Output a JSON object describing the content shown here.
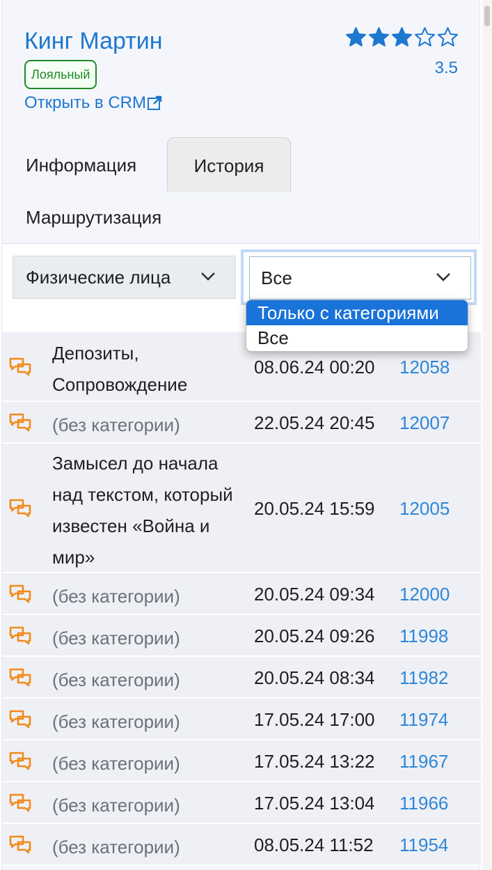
{
  "client": {
    "name": "Кинг Мартин",
    "badge": "Лояльный",
    "crm_link": "Открыть в CRM",
    "rating": "3.5",
    "rating_value": 3.5,
    "rating_max": 5
  },
  "tabs": [
    {
      "label": "Информация",
      "active": false
    },
    {
      "label": "История",
      "active": true
    },
    {
      "label": "Маршрутизация",
      "active": false
    }
  ],
  "filters": {
    "client_type": {
      "value": "Физические лица"
    },
    "category": {
      "value": "Все",
      "options": [
        {
          "label": "Только с категориями",
          "highlighted": true
        },
        {
          "label": "Все",
          "highlighted": false
        }
      ]
    }
  },
  "history": [
    {
      "category": "Депозиты, Сопровождение",
      "has_category": true,
      "date": "08.06.24 00:20",
      "id": "12058"
    },
    {
      "category": "(без категории)",
      "has_category": false,
      "date": "22.05.24 20:45",
      "id": "12007"
    },
    {
      "category": "Замысел до начала над текстом, который известен «Война и мир»",
      "has_category": true,
      "date": "20.05.24 15:59",
      "id": "12005"
    },
    {
      "category": "(без категории)",
      "has_category": false,
      "date": "20.05.24 09:34",
      "id": "12000"
    },
    {
      "category": "(без категории)",
      "has_category": false,
      "date": "20.05.24 09:26",
      "id": "11998"
    },
    {
      "category": "(без категории)",
      "has_category": false,
      "date": "20.05.24 08:34",
      "id": "11982"
    },
    {
      "category": "(без категории)",
      "has_category": false,
      "date": "17.05.24 17:00",
      "id": "11974"
    },
    {
      "category": "(без категории)",
      "has_category": false,
      "date": "17.05.24 13:22",
      "id": "11967"
    },
    {
      "category": "(без категории)",
      "has_category": false,
      "date": "17.05.24 13:04",
      "id": "11966"
    },
    {
      "category": "(без категории)",
      "has_category": false,
      "date": "08.05.24 11:52",
      "id": "11954"
    }
  ],
  "icons": {
    "row_icon": "chat-bubbles-icon",
    "row_icon_color": "#f28a1a",
    "accent": "#1d78cf",
    "badge_color": "#1e8a26"
  }
}
